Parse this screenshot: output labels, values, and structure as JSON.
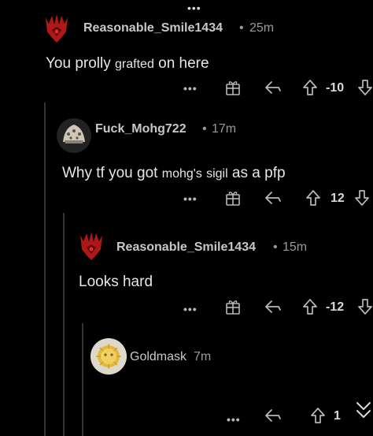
{
  "comments": [
    {
      "username": "Reasonable_Smile1434",
      "age": "25m",
      "body_parts": [
        "You prolly ",
        "grafted",
        " on here"
      ],
      "score": "-10"
    },
    {
      "username": "Fuck_Mohg722",
      "age": "17m",
      "body_parts": [
        "Why tf you got ",
        "mohg's",
        " ",
        "sigil",
        " as a pfp"
      ],
      "score": "12"
    },
    {
      "username": "Reasonable_Smile1434",
      "age": "15m",
      "body_parts": [
        "Looks hard"
      ],
      "score": "-12"
    },
    {
      "username": "Goldmask",
      "age": "7m",
      "score": "1"
    }
  ],
  "separator": "•",
  "more_label": "•••",
  "colors": {
    "background": "#000000",
    "sigil_red": "#b01818",
    "thread_line": "#343536"
  }
}
